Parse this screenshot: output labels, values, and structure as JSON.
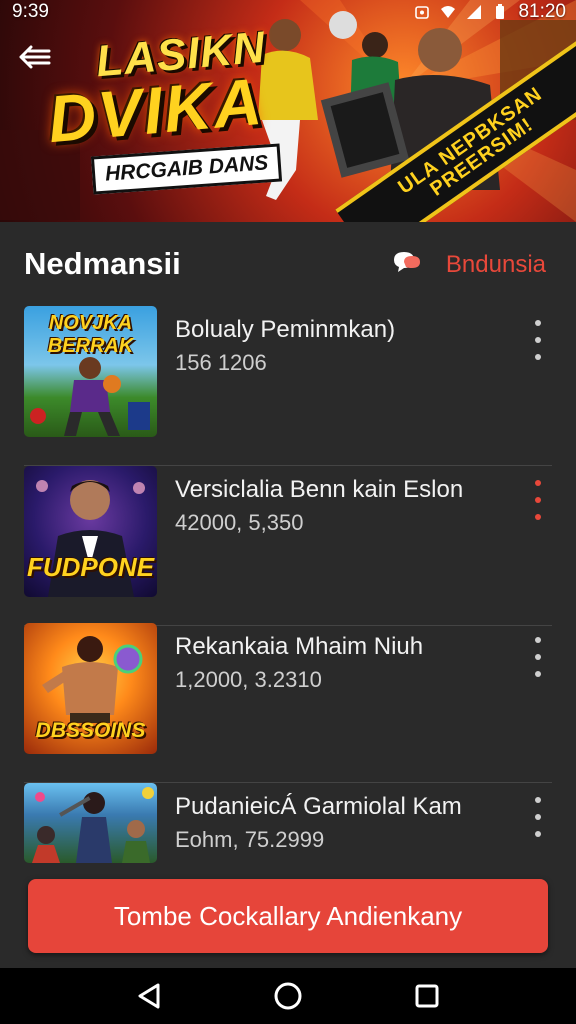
{
  "status_bar": {
    "time_left": "9:39",
    "time_right": "81:20"
  },
  "hero": {
    "logo_line1": "LASIKN",
    "logo_line2": "DVIKA",
    "logo_line3": "HRCGAIB DANS",
    "ribbon_line1": "ULA NEPBKSAN",
    "ribbon_line2": "PREERSIM!"
  },
  "section": {
    "title": "Nedmansii",
    "action_label": "Bndunsia"
  },
  "items": [
    {
      "thumb_label": "NOVJKA BERRAK",
      "title": "Bolualy Peminmkan)",
      "subtitle": "156 1206",
      "menu_color": "grey"
    },
    {
      "thumb_label": "FUDPONE",
      "title": "Versiclalia Benn kain Eslon",
      "subtitle": "42000, 5,350",
      "menu_color": "red"
    },
    {
      "thumb_label": "DBSSOINS",
      "title": "Rekankaia Mhaim Niuh",
      "subtitle": "1,2000, 3.2310",
      "menu_color": "grey"
    },
    {
      "thumb_label": "",
      "title": "PudanieicÁ Garmiolal Kam",
      "subtitle": "Eohm, 75.2999",
      "menu_color": "grey"
    }
  ],
  "cta": {
    "label": "Tombe Cockallary Andienkany"
  },
  "colors": {
    "accent": "#e6453a",
    "panel": "#2a2a2a"
  }
}
